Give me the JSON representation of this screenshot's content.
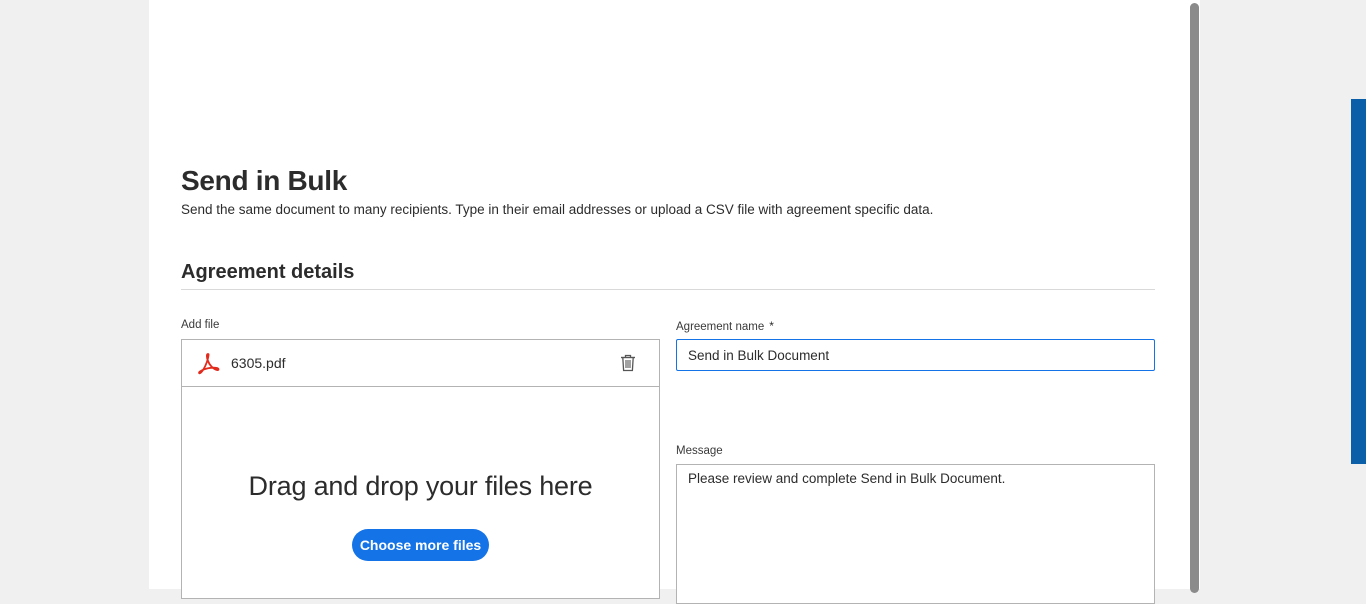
{
  "page": {
    "title": "Send in Bulk",
    "subtitle": "Send the same document to many recipients. Type in their email addresses or upload a CSV file with agreement specific data."
  },
  "agreement_details": {
    "section_title": "Agreement details",
    "add_file": {
      "label": "Add file",
      "file_name": "6305.pdf",
      "file_icon": "pdf-icon",
      "delete_icon": "trash-icon",
      "drop_text": "Drag and drop your files here",
      "choose_button": "Choose more files"
    },
    "agreement_name": {
      "label": "Agreement name",
      "required_marker": "*",
      "value": "Send in Bulk Document"
    },
    "message": {
      "label": "Message",
      "value": "Please review and complete Send in Bulk Document."
    }
  },
  "colors": {
    "accent": "#1473e6",
    "side_accent": "#0b5fa8",
    "pdf_red": "#e22b1c"
  }
}
